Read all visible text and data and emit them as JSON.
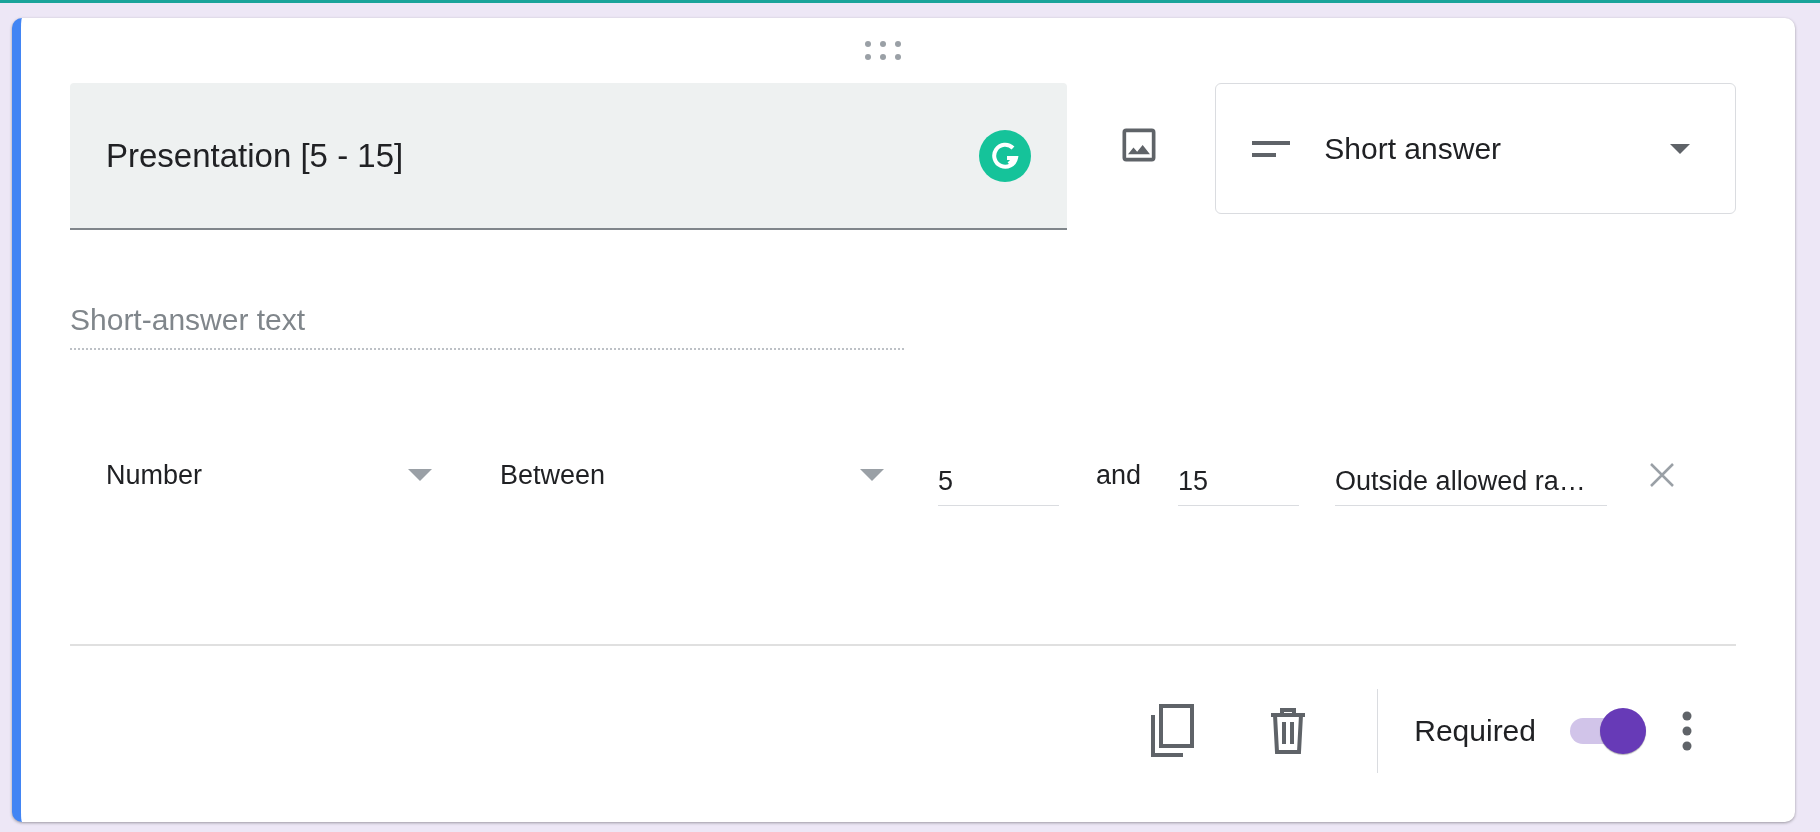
{
  "question": {
    "title": "Presentation [5 - 15]",
    "type": "Short answer"
  },
  "answer": {
    "placeholder": "Short-answer text"
  },
  "validation": {
    "kind_select": "Number",
    "condition_select": "Between",
    "min": "5",
    "joiner": "and",
    "max": "15",
    "error_text": "Outside allowed ra…"
  },
  "footer": {
    "required_label": "Required",
    "required": true
  }
}
